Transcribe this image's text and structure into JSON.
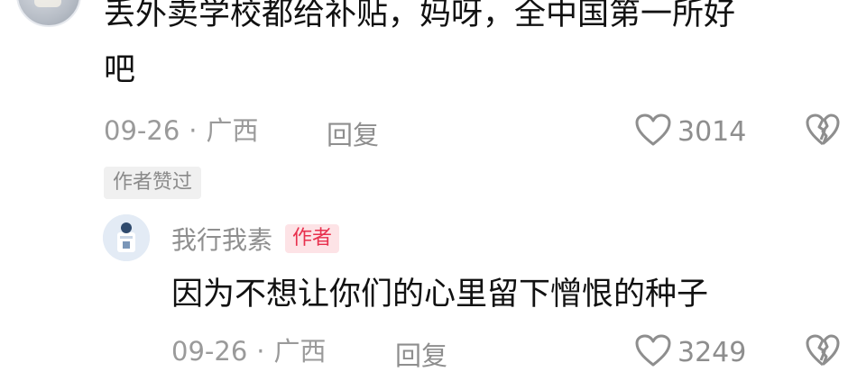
{
  "main_comment": {
    "text_line1": "丢外卖学校都给补贴，妈呀，全中国第一所好",
    "text_line2": "吧",
    "date": "09-26",
    "separator": "·",
    "location": "广西",
    "reply_label": "回复",
    "like_count": "3014",
    "liked_by_author_tag": "作者赞过"
  },
  "reply_comment": {
    "username": "我行我素",
    "author_badge": "作者",
    "text": "因为不想让你们的心里留下憎恨的种子",
    "date": "09-26",
    "separator": "·",
    "location": "广西",
    "reply_label": "回复",
    "like_count": "3249"
  },
  "icons": {
    "like": "heart-outline-icon",
    "dislike": "broken-heart-icon"
  },
  "colors": {
    "author_badge_text": "#e8304d",
    "author_badge_bg": "#fde3e6",
    "meta_gray": "#9a9a9a"
  }
}
